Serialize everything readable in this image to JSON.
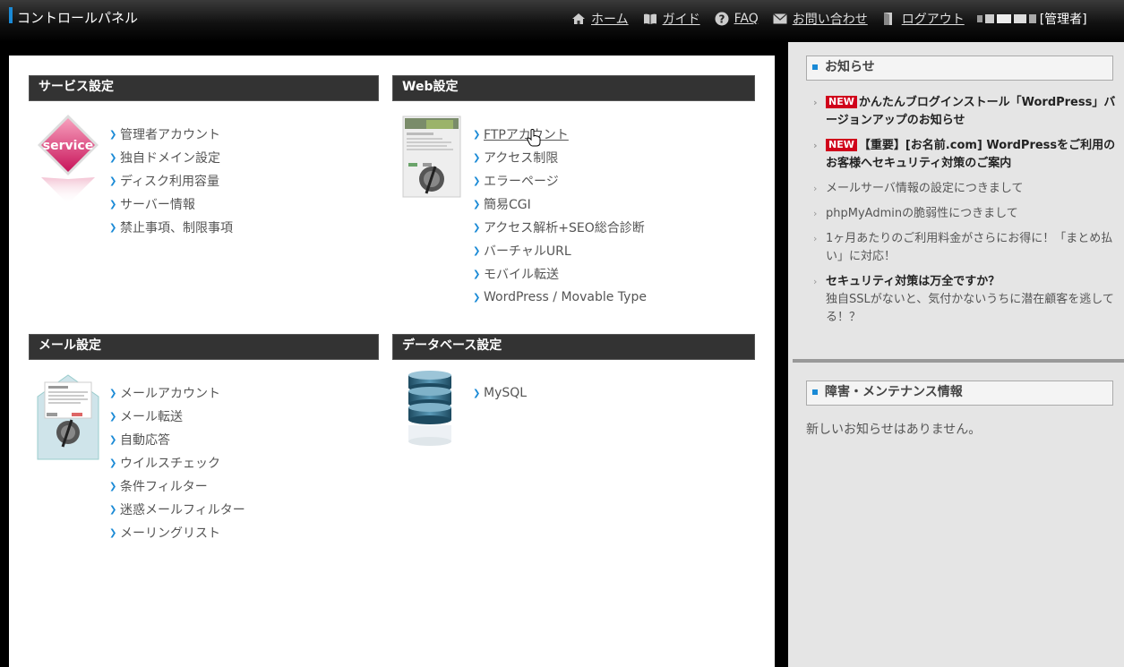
{
  "header": {
    "title": "コントロールパネル",
    "nav": [
      {
        "icon": "home-icon",
        "label": "ホーム"
      },
      {
        "icon": "book-icon",
        "label": "ガイド"
      },
      {
        "icon": "question-icon",
        "label": "FAQ"
      },
      {
        "icon": "mail-icon",
        "label": "お問い合わせ"
      },
      {
        "icon": "logout-icon",
        "label": "ログアウト"
      }
    ],
    "user_role": "[管理者]"
  },
  "sections": {
    "service": {
      "title": "サービス設定",
      "icon": "service-badge-icon",
      "icon_text": "service",
      "links": [
        "管理者アカウント",
        "独自ドメイン設定",
        "ディスク利用容量",
        "サーバー情報",
        "禁止事項、制限事項"
      ]
    },
    "web": {
      "title": "Web設定",
      "icon": "web-page-icon",
      "links": [
        "FTPアカウント",
        "アクセス制限",
        "エラーページ",
        "簡易CGI",
        "アクセス解析+SEO総合診断",
        "バーチャルURL",
        "モバイル転送",
        "WordPress / Movable Type"
      ]
    },
    "mail": {
      "title": "メール設定",
      "icon": "mail-envelope-icon",
      "links": [
        "メールアカウント",
        "メール転送",
        "自動応答",
        "ウイルスチェック",
        "条件フィルター",
        "迷惑メールフィルター",
        "メーリングリスト"
      ]
    },
    "database": {
      "title": "データベース設定",
      "icon": "database-icon",
      "links": [
        "MySQL"
      ]
    }
  },
  "sidebar": {
    "news_title": "お知らせ",
    "new_badge": "NEW",
    "news": {
      "item1": "かんたんブログインストール「WordPress」バージョンアップのお知らせ",
      "item2": "【重要】[お名前.com] WordPressをご利用のお客様へセキュリティ対策のご案内",
      "item3": "メールサーバ情報の設定につきまして",
      "item4": "phpMyAdminの脆弱性につきまして",
      "item5": "1ヶ月あたりのご利用料金がさらにお得に！「まとめ払い」に対応！",
      "item6_title": "セキュリティ対策は万全ですか？",
      "item6_body": "独自SSLがないと、気付かないうちに潜在顧客を逃してる！？"
    },
    "maintenance_title": "障害・メンテナンス情報",
    "maintenance_text": "新しいお知らせはありません。"
  },
  "colors": {
    "accent": "#1a8ad6",
    "new_badge": "#d0021b",
    "header_bg": "#111111",
    "section_head_bg": "#333333",
    "sidebar_bg": "#e5e5e5"
  }
}
